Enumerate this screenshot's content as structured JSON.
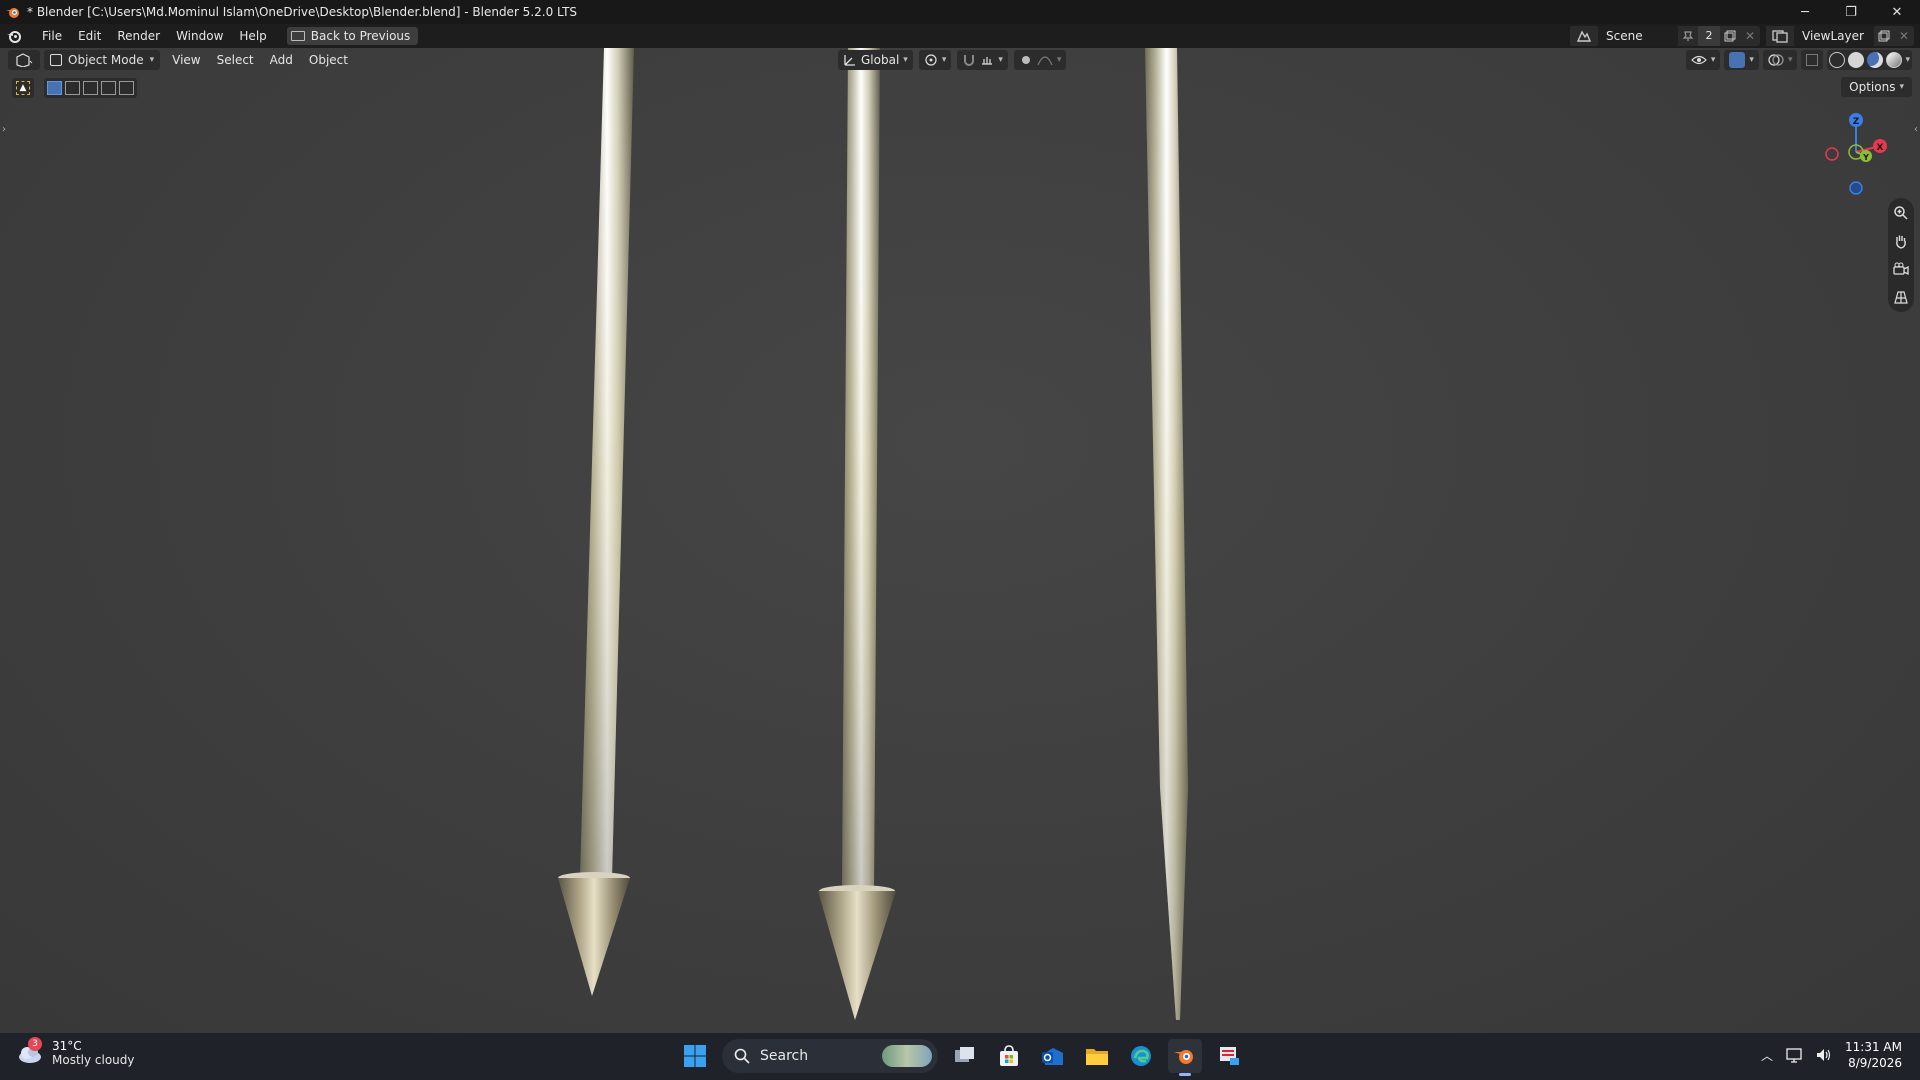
{
  "window": {
    "title": "* Blender [C:\\Users\\Md.Mominul Islam\\OneDrive\\Desktop\\Blender.blend] - Blender 5.2.0 LTS",
    "controls": {
      "minimize": "─",
      "restore": "❐",
      "close": "✕"
    }
  },
  "menu": {
    "items": [
      "File",
      "Edit",
      "Render",
      "Window",
      "Help"
    ],
    "back_button": "Back to Previous"
  },
  "scene": {
    "name": "Scene",
    "count": "2"
  },
  "view_layer": {
    "name": "ViewLayer"
  },
  "viewport_header": {
    "mode": "Object Mode",
    "menus": [
      "View",
      "Select",
      "Add",
      "Object"
    ],
    "transform_orientation": "Global",
    "options_label": "Options"
  },
  "gizmo": {
    "z": "Z",
    "y": "Y",
    "x": "X"
  },
  "colors": {
    "accent": "#4772b3",
    "x_axis": "#e8384f",
    "y_axis": "#8bbd36",
    "z_axis": "#3a7ee8",
    "viewport_bg": "#3f3f3f"
  },
  "icons": {
    "nav": [
      "zoom-icon",
      "hand-pan-icon",
      "camera-view-icon",
      "grid-ortho-icon"
    ]
  },
  "taskbar": {
    "weather_temp": "31°C",
    "weather_desc": "Mostly cloudy",
    "weather_badge": "3",
    "search_label": "Search",
    "time": "11:31 AM",
    "date": "8/9/2026"
  }
}
